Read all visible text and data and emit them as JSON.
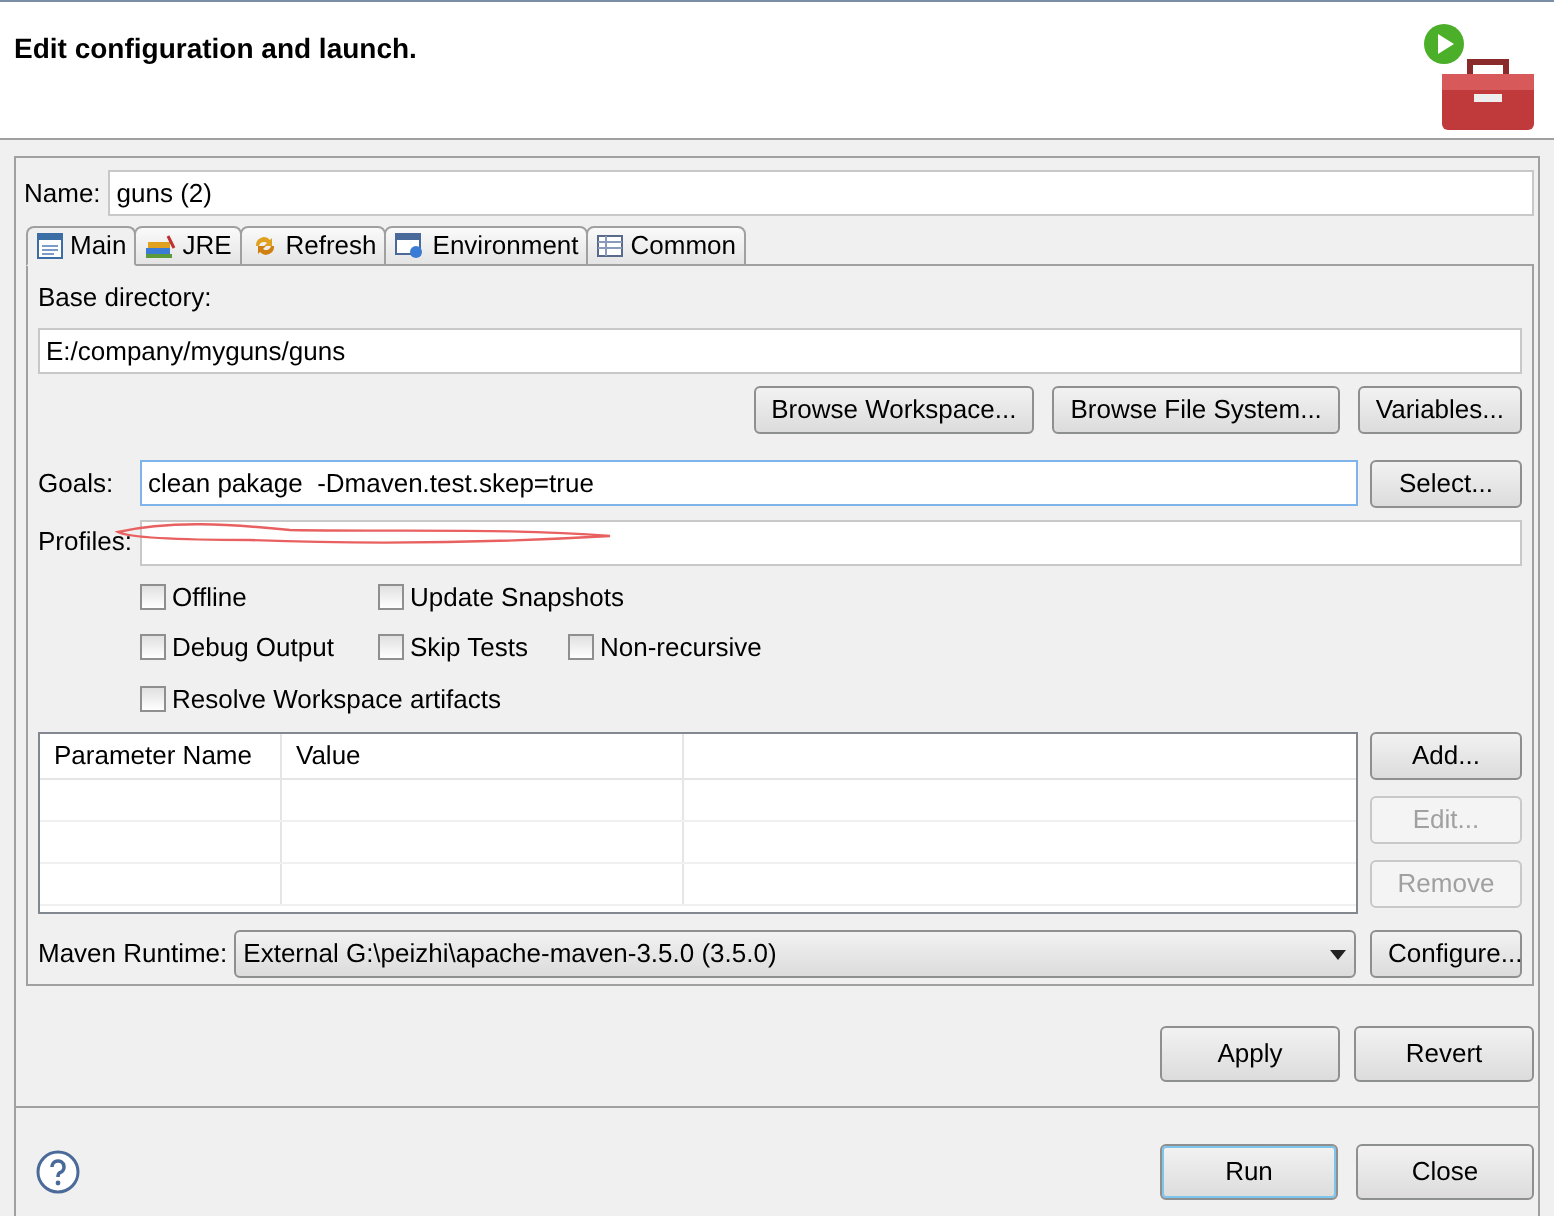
{
  "header": {
    "message": "Edit configuration and launch."
  },
  "name_field": {
    "label": "Name:",
    "value": "guns (2)"
  },
  "tabs": [
    {
      "label": "Main",
      "selected": true
    },
    {
      "label": "JRE",
      "selected": false
    },
    {
      "label": "Refresh",
      "selected": false
    },
    {
      "label": "Environment",
      "selected": false
    },
    {
      "label": "Common",
      "selected": false
    }
  ],
  "base_directory": {
    "label": "Base directory:",
    "value": "E:/company/myguns/guns",
    "buttons": [
      "Browse Workspace...",
      "Browse File System...",
      "Variables..."
    ]
  },
  "goals": {
    "label": "Goals:",
    "value": "clean pakage  -Dmaven.test.skep=true",
    "button": "Select..."
  },
  "profiles": {
    "label": "Profiles:"
  },
  "options": [
    [
      {
        "label": "Offline",
        "checked": false
      },
      {
        "label": "Update Snapshots",
        "checked": false
      }
    ],
    [
      {
        "label": "Debug Output",
        "checked": false
      },
      {
        "label": "Skip Tests",
        "checked": false
      },
      {
        "label": "Non-recursive",
        "checked": false
      }
    ],
    [
      {
        "label": "Resolve Workspace artifacts",
        "checked": false
      }
    ]
  ],
  "parameters": {
    "columns": [
      "Parameter Name",
      "Value"
    ],
    "buttons": [
      {
        "label": "Add...",
        "disabled": false
      },
      {
        "label": "Edit...",
        "disabled": true
      },
      {
        "label": "Remove",
        "disabled": true
      }
    ]
  },
  "maven_runtime": {
    "label": "Maven Runtime:",
    "value": "External G:\\peizhi\\apache-maven-3.5.0 (3.5.0)",
    "button": "Configure..."
  },
  "actions": [
    "Apply",
    "Revert"
  ],
  "footer": {
    "buttons": [
      {
        "label": "Run",
        "default": true
      },
      {
        "label": "Close",
        "default": false
      }
    ]
  }
}
